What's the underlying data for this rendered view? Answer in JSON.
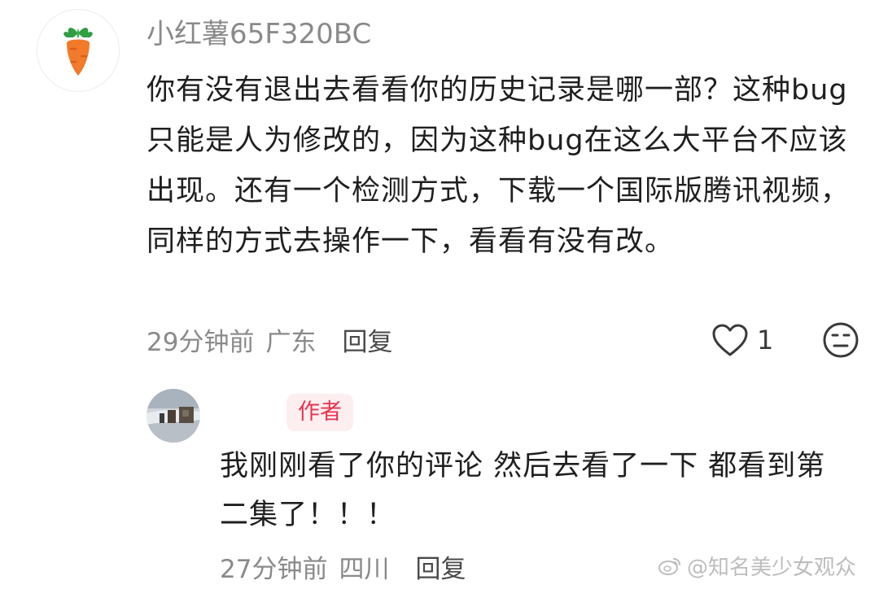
{
  "comment": {
    "username": "小红薯65F320BC",
    "body": "你有没有退出去看看你的历史记录是哪一部？这种bug只能是人为修改的，因为这种bug在这么大平台不应该出现。还有一个检测方式，下载一个国际版腾讯视频，同样的方式去操作一下，看看有没有改。",
    "time": "29分钟前",
    "location": "广东",
    "reply_label": "回复",
    "like_count": "1",
    "avatar_icon": "carrot-icon",
    "like_icon": "heart-outline-icon",
    "dislike_icon": "meh-face-icon"
  },
  "reply": {
    "author_badge": "作者",
    "body": "我刚刚看了你的评论 然后去看了一下 都看到第二集了！！！",
    "time": "27分钟前",
    "location": "四川",
    "reply_label": "回复"
  },
  "watermark": {
    "text": "@知名美少女观众",
    "icon": "weibo-icon"
  },
  "colors": {
    "author_badge_text": "#e8344e",
    "author_badge_bg": "#fdeef0",
    "meta_text": "#8a8a8a",
    "carrot": "#f27a2a"
  }
}
